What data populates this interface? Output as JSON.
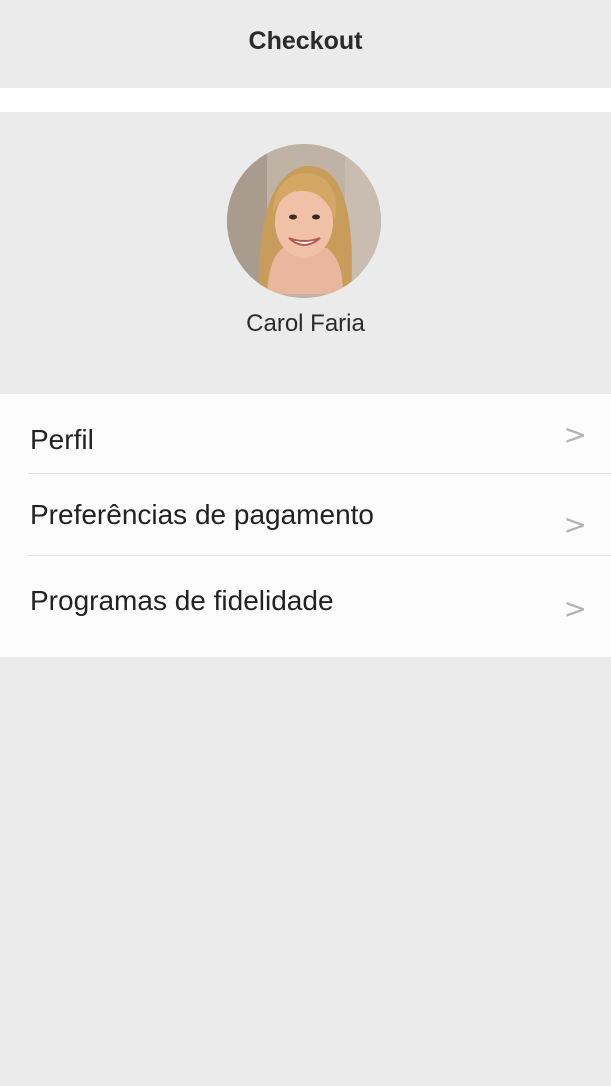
{
  "header": {
    "title": "Checkout"
  },
  "profile": {
    "name": "Carol Faria",
    "avatar_icon": "profile-photo"
  },
  "menu": {
    "items": [
      {
        "label": "Perfil",
        "chevron": ">"
      },
      {
        "label": "Preferências de pagamento",
        "chevron": ">"
      },
      {
        "label": "Programas de fidelidade",
        "chevron": ">"
      }
    ]
  },
  "colors": {
    "background": "#ebebeb",
    "menu_background": "#fcfcfc",
    "text": "#222222",
    "chevron": "#b4b4b4"
  }
}
